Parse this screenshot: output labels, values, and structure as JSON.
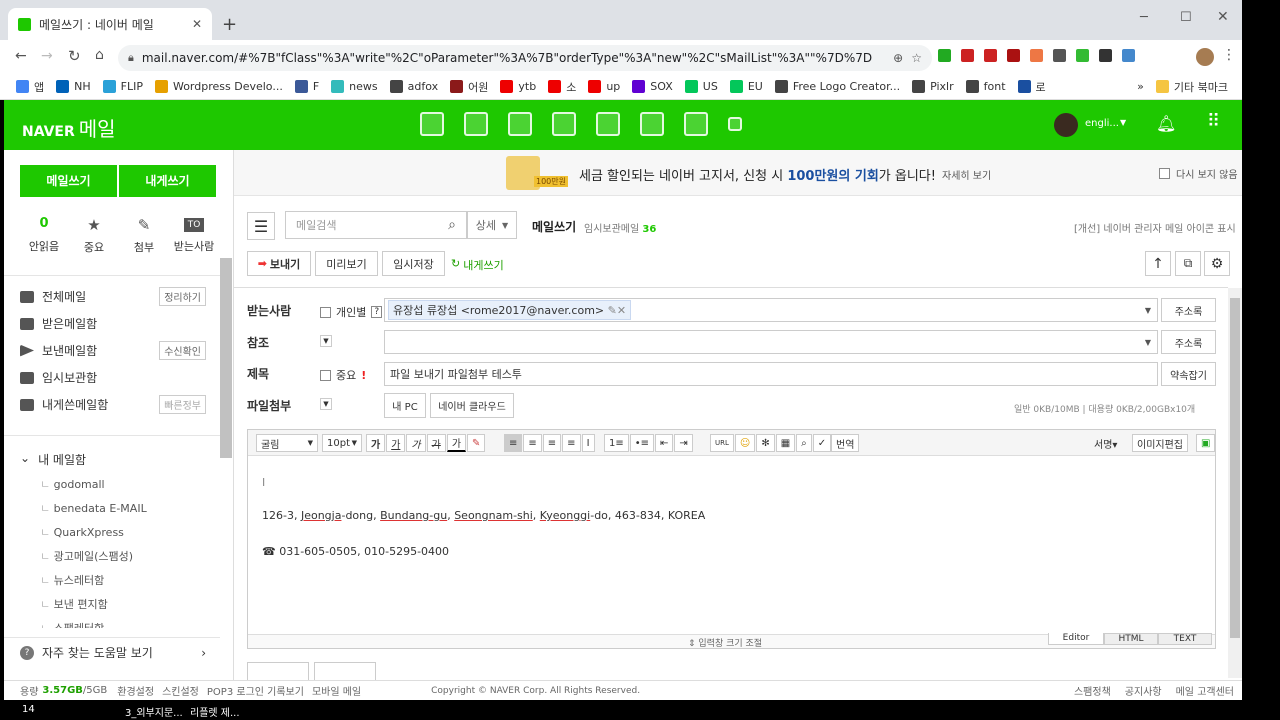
{
  "browser": {
    "tab_title": "메일쓰기 : 네이버 메일",
    "url": "mail.naver.com/#%7B\"fClass\"%3A\"write\"%2C\"oParameter\"%3A%7B\"orderType\"%3A\"new\"%2C\"sMailList\"%3A\"\"%7D%7D",
    "bookmarks": [
      {
        "label": "앱",
        "color": "#4285f4"
      },
      {
        "label": "NH",
        "color": "#0062b8"
      },
      {
        "label": "FLIP",
        "color": "#2aa1d8"
      },
      {
        "label": "Wordpress Develo...",
        "color": "#e6a000"
      },
      {
        "label": "F",
        "color": "#3b5998"
      },
      {
        "label": "news",
        "color": "#3bb"
      },
      {
        "label": "adfox",
        "color": "#444"
      },
      {
        "label": "어원",
        "color": "#8b1a1a"
      },
      {
        "label": "ytb",
        "color": "#e00"
      },
      {
        "label": "소",
        "color": "#e00"
      },
      {
        "label": "up",
        "color": "#e00"
      },
      {
        "label": "SOX",
        "color": "#6001d2"
      },
      {
        "label": "US",
        "color": "#03c75a"
      },
      {
        "label": "EU",
        "color": "#03c75a"
      },
      {
        "label": "Free Logo Creator...",
        "color": "#444"
      },
      {
        "label": "Pixlr",
        "color": "#444"
      },
      {
        "label": "font",
        "color": "#444"
      },
      {
        "label": "로",
        "color": "#1a4fa0"
      }
    ],
    "other_bookmarks": "기타 북마크"
  },
  "header": {
    "brand": "NAVER",
    "service": "메일",
    "user": "engli..."
  },
  "left": {
    "write_btn": "메일쓰기",
    "self_btn": "내게쓰기",
    "quick": [
      {
        "count": "0",
        "label": "안읽음"
      },
      {
        "label": "중요"
      },
      {
        "label": "첨부"
      },
      {
        "label": "받는사람"
      }
    ],
    "folders": [
      {
        "label": "전체메일",
        "btn": "정리하기"
      },
      {
        "label": "받은메일함"
      },
      {
        "label": "보낸메일함",
        "btn": "수신확인"
      },
      {
        "label": "임시보관함"
      },
      {
        "label": "내게쓴메일함",
        "btn": "빠른정부"
      }
    ],
    "my_folder_title": "내 메일함",
    "my_folders": [
      "godomall",
      "benedata E-MAIL",
      "QuarkXpress",
      "광고메일(스팸성)",
      "뉴스레터함",
      "보낸 편지함",
      "스팸레터함"
    ],
    "help": "자주 찾는 도움말 보기"
  },
  "banner": {
    "badge": "100만원",
    "text_pre": "세금 할인되는 네이버 고지서, 신청 시 ",
    "highlight": "100만원의 기회",
    "text_post": "가 옵니다!",
    "more": "자세히 보기",
    "dismiss": "다시 보지 않음"
  },
  "compose": {
    "search_placeholder": "메일검색",
    "detail": "상세",
    "title": "메일쓰기",
    "temp_label": "임시보관메일",
    "temp_count": "36",
    "admin_note": "[개선] 네이버 관리자 메일 아이콘 표시",
    "send": "보내기",
    "preview": "미리보기",
    "save": "임시저장",
    "to_self": "내게쓰기",
    "to_label": "받는사람",
    "individual": "개인별",
    "recipient": "유장섭 류장섭 <rome2017@naver.com>",
    "addr_btn": "주소록",
    "cc_label": "참조",
    "subject_label": "제목",
    "important": "중요",
    "subject": "파일 보내기 파일첨부 테스투",
    "appointment": "약속잡기",
    "attach_label": "파일첨부",
    "my_pc": "내 PC",
    "cloud": "네이버 클라우드",
    "quota": "일반 0KB/10MB  |  대용량 0KB/2,00GBx10개",
    "font": "굴림",
    "size": "10pt",
    "translate": "번역",
    "sign": "서명",
    "image_edit": "이미지편집",
    "body_line1_parts": [
      "126-3, ",
      "Jeongja",
      "-dong, ",
      "Bundang-gu",
      ", ",
      "Seongnam-shi",
      ", ",
      "Kyeonggi",
      "-do, 463-834, KOREA"
    ],
    "body_line2": "☎ 031-605-0505, 010-5295-0400",
    "resize": "⇕ 입력창 크기 조절",
    "tabs": [
      "Editor",
      "HTML",
      "TEXT"
    ]
  },
  "footer": {
    "usage_label": "용량",
    "usage": "3.57GB",
    "total": "/5GB",
    "links": [
      "환경설정",
      "스킨설정",
      "POP3 로그인 기록보기",
      "모바일 메일"
    ],
    "copyright": "Copyright © NAVER Corp. All Rights Reserved.",
    "right": [
      "스팸정책",
      "공지사항",
      "메일 고객센터"
    ]
  },
  "taskbar": {
    "items": [
      "14",
      "3_외부지문...",
      "리플렛 제..."
    ]
  }
}
